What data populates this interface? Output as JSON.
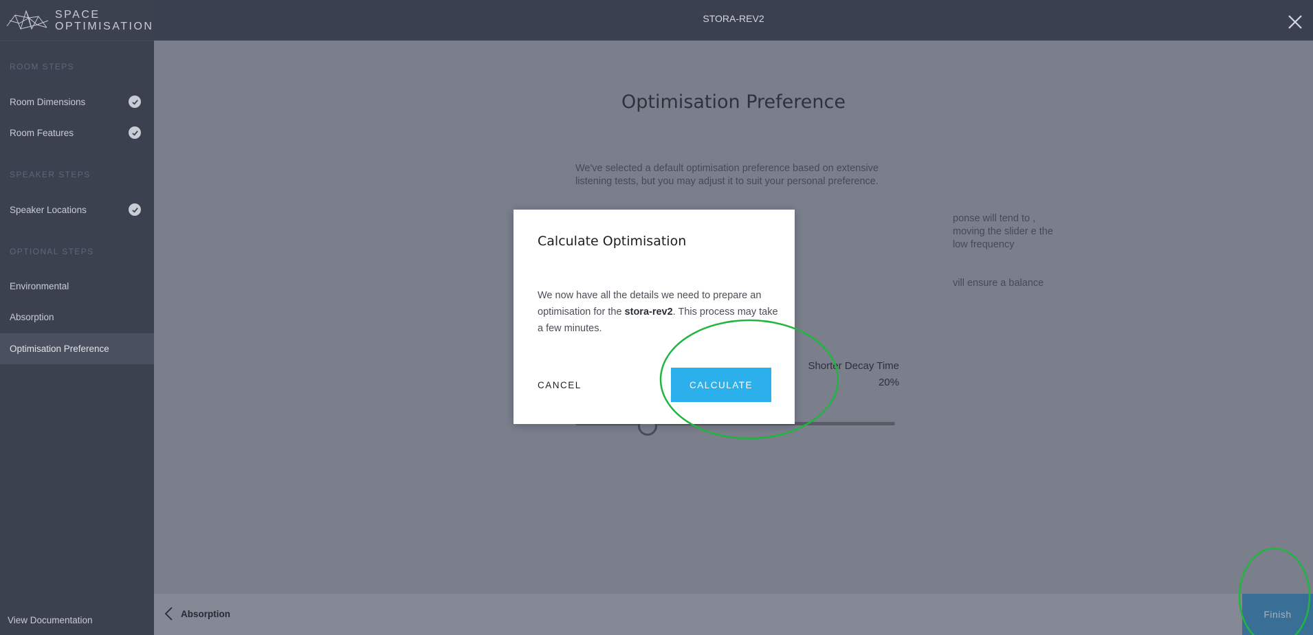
{
  "brand": {
    "line1": "SPACE",
    "line2": "OPTIMISATION"
  },
  "topbar": {
    "title": "STORA-REV2"
  },
  "sidebar": {
    "sections": [
      {
        "title": "ROOM STEPS"
      },
      {
        "title": "SPEAKER STEPS"
      },
      {
        "title": "OPTIONAL STEPS"
      }
    ],
    "items": [
      {
        "label": "Room Dimensions",
        "completed": true
      },
      {
        "label": "Room Features",
        "completed": true
      },
      {
        "label": "Speaker Locations",
        "completed": true
      },
      {
        "label": "Environmental",
        "completed": false
      },
      {
        "label": "Absorption",
        "completed": false
      },
      {
        "label": "Optimisation Preference",
        "completed": false,
        "active": true
      }
    ],
    "view_documentation": "View Documentation"
  },
  "main": {
    "title": "Optimisation Preference",
    "paragraph1": "We've selected a default optimisation preference based on extensive listening tests, but you may adjust it to suit your personal preference.",
    "paragraph2": "ponse will tend to , moving the slider e the low frequency",
    "paragraph3": "vill ensure a balance",
    "slider_label": "Shorter Decay Time",
    "slider_value": "20%"
  },
  "bottombar": {
    "back_label": "Absorption",
    "finish_label": "Finish"
  },
  "modal": {
    "title": "Calculate Optimisation",
    "body_prefix": "We now have all the details we need to prepare an optimisation for the ",
    "body_bold": "stora-rev2",
    "body_suffix": ". This process may take a few minutes.",
    "cancel_label": "CANCEL",
    "calculate_label": "CALCULATE"
  },
  "colors": {
    "accent": "#2cb0ec",
    "annotation": "#1fb640",
    "sidebar_bg": "#3c4150",
    "overlay_bg": "#7b7f8c"
  }
}
